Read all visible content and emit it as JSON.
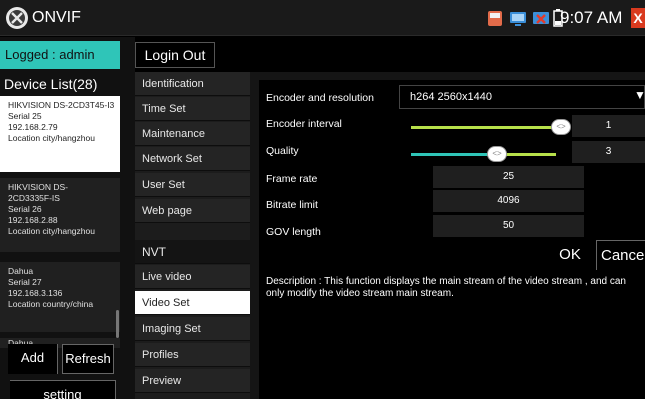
{
  "app": {
    "title": "ONVIF",
    "time": "9:07 AM",
    "close_glyph": "X"
  },
  "status_icons": [
    "sd-card-icon",
    "monitor-icon",
    "network-off-icon",
    "battery-icon"
  ],
  "header": {
    "logged": "Logged : admin",
    "login_out": "Login Out"
  },
  "device_list": {
    "title": "Device List(28)",
    "devices": [
      {
        "name": "HIKVISION DS-2CD3T45-I3",
        "serial": "Serial 25",
        "ip": "192.168.2.79",
        "location": "Location city/hangzhou"
      },
      {
        "name": "HIKVISION DS-2CD3335F-IS",
        "serial": "Serial 26",
        "ip": "192.168.2.88",
        "location": "Location city/hangzhou"
      },
      {
        "name": "Dahua",
        "serial": "Serial 27",
        "ip": "192.168.3.136",
        "location": "Location country/china"
      },
      {
        "name": "Dahua"
      }
    ]
  },
  "buttons": {
    "add": "Add",
    "refresh": "Refresh",
    "setting": "setting"
  },
  "menu": {
    "items": [
      "Identification",
      "Time Set",
      "Maintenance",
      "Network Set",
      "User Set",
      "Web page"
    ],
    "nvt_header": "NVT",
    "nvt_items": [
      "Live video",
      "Video Set",
      "Imaging Set",
      "Profiles",
      "Preview"
    ]
  },
  "video_set": {
    "encoder_label": "Encoder and resolution",
    "encoder_value": "h264 2560x1440",
    "interval_label": "Encoder interval",
    "interval_value": "1",
    "quality_label": "Quality",
    "quality_value": "3",
    "framerate_label": "Frame rate",
    "framerate_value": "25",
    "bitrate_label": "Bitrate limit",
    "bitrate_value": "4096",
    "gov_label": "GOV length",
    "gov_value": "50",
    "ok": "OK",
    "cancel": "Cancel",
    "description": "Description : This function displays the main stream of the video stream , and can only modify the video stream main stream."
  },
  "colors": {
    "accent": "#2fc5b8",
    "slider_green": "#b7e04a",
    "close_red": "#d93a1f"
  }
}
